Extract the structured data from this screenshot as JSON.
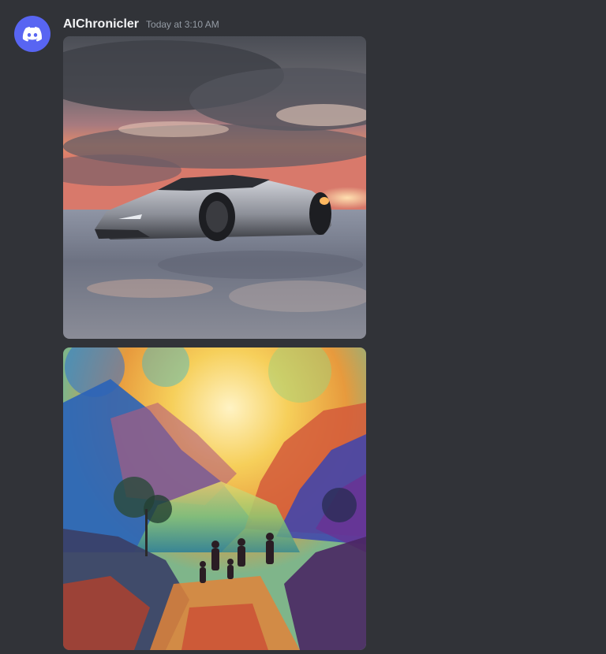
{
  "message": {
    "author": "AIChronicler",
    "timestamp": "Today at 3:10 AM",
    "avatar_icon": "discord-logo-icon",
    "avatar_color": "#5865f2"
  },
  "attachments": [
    {
      "subject": "futuristic-silver-sports-car-on-wet-salt-flat-at-sunset"
    },
    {
      "subject": "watercolor-rainbow-mountains-with-family-silhouettes"
    }
  ],
  "colors": {
    "background": "#313338",
    "username": "#f2f3f5",
    "timestamp": "#949ba4"
  }
}
